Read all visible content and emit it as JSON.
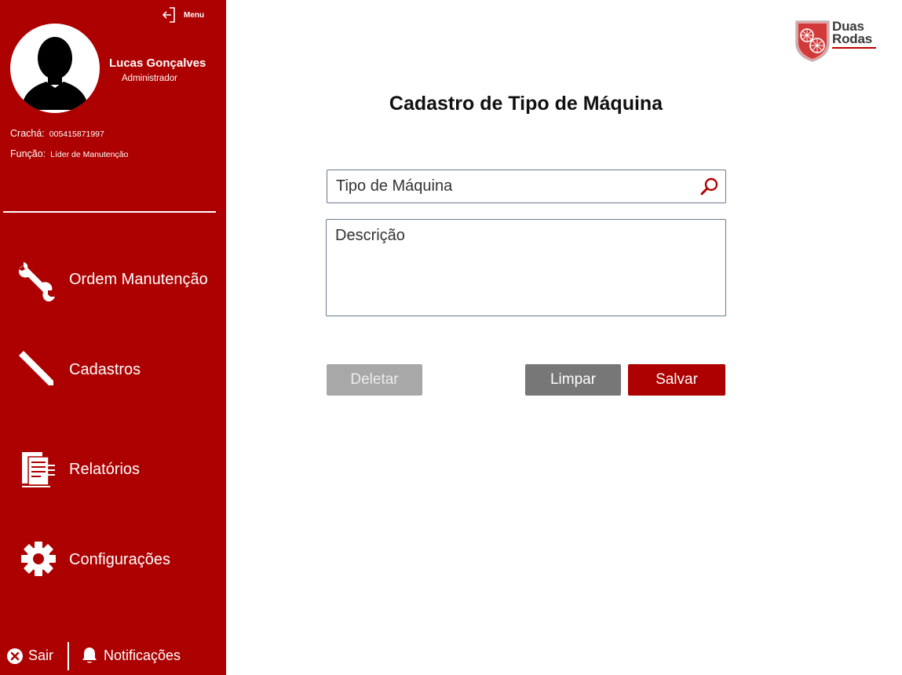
{
  "sidebar": {
    "menu_label": "Menu",
    "user": {
      "name": "Lucas Gonçalves",
      "role": "Administrador",
      "badge_label": "Crachá:",
      "badge_value": "005415871997",
      "function_label": "Função:",
      "function_value": "Líder de Manutenção"
    },
    "nav": [
      {
        "label": "Ordem Manutenção",
        "icon": "wrench-icon"
      },
      {
        "label": "Cadastros",
        "icon": "pencil-icon"
      },
      {
        "label": "Relatórios",
        "icon": "report-icon"
      },
      {
        "label": "Configurações",
        "icon": "gear-icon"
      }
    ],
    "exit_label": "Sair",
    "notifications_label": "Notificações"
  },
  "logo": {
    "line1": "Duas",
    "line2": "Rodas"
  },
  "main": {
    "title": "Cadastro de Tipo de Máquina",
    "machine_type_placeholder": "Tipo de Máquina",
    "description_placeholder": "Descrição",
    "delete_label": "Deletar",
    "clear_label": "Limpar",
    "save_label": "Salvar"
  },
  "colors": {
    "sidebar": "#ad0000",
    "primary": "#ad0000",
    "disabled": "#a8a8a8",
    "secondary": "#777777"
  }
}
